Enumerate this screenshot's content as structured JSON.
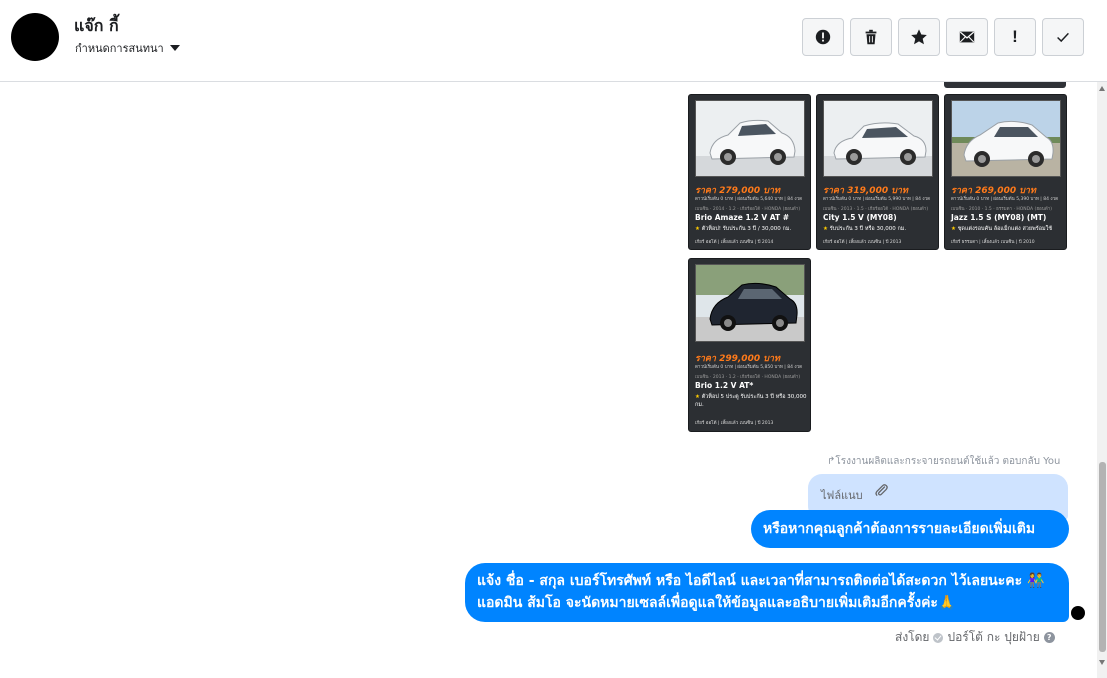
{
  "header": {
    "contact_name": "แจ๊ก กี้",
    "assign_label": "กำหนดการสนทนา",
    "actions": [
      {
        "name": "report",
        "icon": "alert-circle-icon"
      },
      {
        "name": "delete",
        "icon": "trash-icon"
      },
      {
        "name": "star",
        "icon": "star-icon"
      },
      {
        "name": "mark-unread",
        "icon": "envelope-icon"
      },
      {
        "name": "important",
        "icon": "exclamation-icon",
        "glyph": "!"
      },
      {
        "name": "done",
        "icon": "checkmark-icon"
      }
    ]
  },
  "cars": [
    {
      "price": "ราคา 279,000 บาท",
      "spec": "ดาวน์เริ่มต้น 0 บาท | ผ่อนเริ่มต้น 5,640 บาท | 84 งวด",
      "sub": "เบนซิน · 2014 · 1.2 · เกียร์ออโต้ · HONDA (ฮอนด้า)",
      "model": "Brio Amaze 1.2 V AT #",
      "feature": "ตัวท็อป! รับประกัน 3 ปี / 30,000 กม.",
      "meta": "เกียร์ ออโต้  |  เลี้ยงแล้ว เบนซิน  |  ปี 2014"
    },
    {
      "price": "ราคา 319,000 บาท",
      "spec": "ดาวน์เริ่มต้น 0 บาท | ผ่อนเริ่มต้น 5,990 บาท | 84 งวด",
      "sub": "เบนซิน · 2013 · 1.5 · เกียร์ออโต้ · HONDA (ฮอนด้า)",
      "model": "City 1.5 V (MY08)",
      "feature": "รับประกัน 3 ปี หรือ 30,000 กม.",
      "meta": "เกียร์ ออโต้  |  เลี้ยงแล้ว เบนซิน  |  ปี 2013"
    },
    {
      "price": "ราคา 269,000 บาท",
      "spec": "ดาวน์เริ่มต้น 0 บาท | ผ่อนเริ่มต้น 5,390 บาท | 84 งวด",
      "sub": "เบนซิน · 2010 · 1.5 · ธรรมดา · HONDA (ฮอนด้า)",
      "model": "Jazz 1.5 S (MY08) (MT)",
      "feature": "ชุดแต่งรอบคัน ล้อแม็กแต่ง สวยพร้อมใช้",
      "meta": "เกียร์ ธรรมดา  |  เลี้ยงแล้ว เบนซิน  |  ปี 2010"
    },
    {
      "price": "ราคา 299,000 บาท",
      "spec": "ดาวน์เริ่มต้น 0 บาท | ผ่อนเริ่มต้น 5,850 บาท | 84 งวด",
      "sub": "เบนซิน · 2013 · 1.2 · เกียร์ออโต้ · HONDA (ฮอนด้า)",
      "model": "Brio 1.2 V AT*",
      "feature": "ตัวท็อป 5 ประตู รับประกัน 3 ปี หรือ 30,000 กม.",
      "meta": "เกียร์ ออโต้  |  เลี้ยงแล้ว เบนซิน  |  ปี 2013"
    }
  ],
  "conversation": {
    "reply_note": "↱โรงงานผลิตและกระจายรถยนต์ใช้แล้ว ตอบกลับ You",
    "attachment_label": "ไฟล์แนบ",
    "message1": "หรือหากคุณลูกค้าต้องการรายละเอียดเพิ่มเติม",
    "message2": "แจ้ง ชื่อ - สกุล เบอร์โทรศัพท์ หรือ ไอดีไลน์ และเวลาที่สามารถติดต่อได้สะดวก ไว้เลยนะคะ 👫แอดมิน ส้มโอ จะนัดหมายเซลล์เพื่อดูแลให้ข้อมูลและอธิบายเพิ่มเติมอีกครั้งค่ะ🙏",
    "sent_by_prefix": "ส่งโดย",
    "sent_by_name": "ปอร์โต้ กะ ปุยฝ้าย",
    "help": "?"
  },
  "colors": {
    "bubble": "#0084ff",
    "attachment_bubble": "#cfe3ff",
    "card_bg": "#2c2f33",
    "price": "#ff7a1a"
  }
}
